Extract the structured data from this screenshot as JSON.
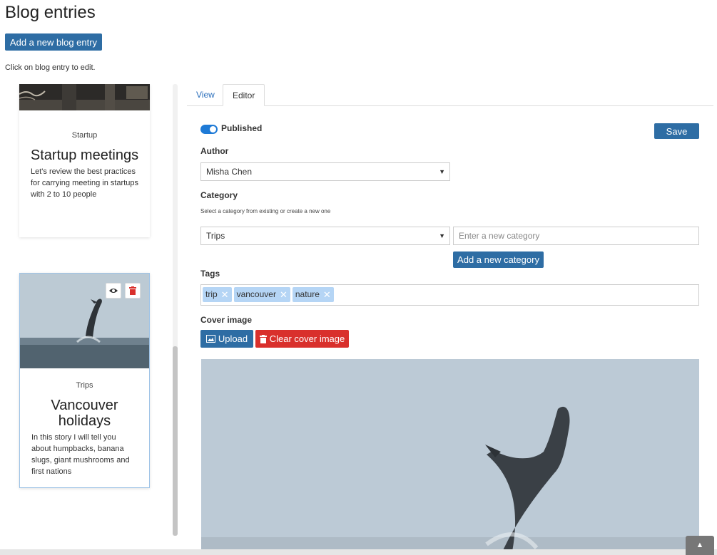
{
  "page": {
    "title": "Blog entries",
    "add_entry_label": "Add a new blog entry",
    "hint": "Click on blog entry to edit."
  },
  "entries": [
    {
      "category": "Startup",
      "title": "Startup meetings",
      "description": "Let's review the best practices for carrying meeting in startups with 2 to 10 people"
    },
    {
      "category": "Trips",
      "title": "Vancouver holidays",
      "description": "In this story I will tell you about humpbacks, banana slugs, giant mushrooms and first nations"
    }
  ],
  "tabs": {
    "view": "View",
    "editor": "Editor"
  },
  "editor": {
    "published_label": "Published",
    "published": true,
    "save_label": "Save",
    "author_label": "Author",
    "author_value": "Misha Chen",
    "category_label": "Category",
    "category_help": "Select a category from existing or create a new one",
    "category_value": "Trips",
    "new_category_placeholder": "Enter a new category",
    "add_category_label": "Add a new category",
    "tags_label": "Tags",
    "tags": [
      "trip",
      "vancouver",
      "nature"
    ],
    "cover_label": "Cover image",
    "upload_label": "Upload",
    "clear_label": "Clear cover image"
  },
  "icons": {
    "view": "eye-icon",
    "delete": "trash-icon",
    "upload": "image-icon",
    "clear": "trash-icon",
    "to_top": "chevron-up-icon"
  },
  "colors": {
    "primary": "#2e6da4",
    "danger": "#d9302c",
    "toggle": "#1e7ad6",
    "tag": "#b5d5f5"
  }
}
